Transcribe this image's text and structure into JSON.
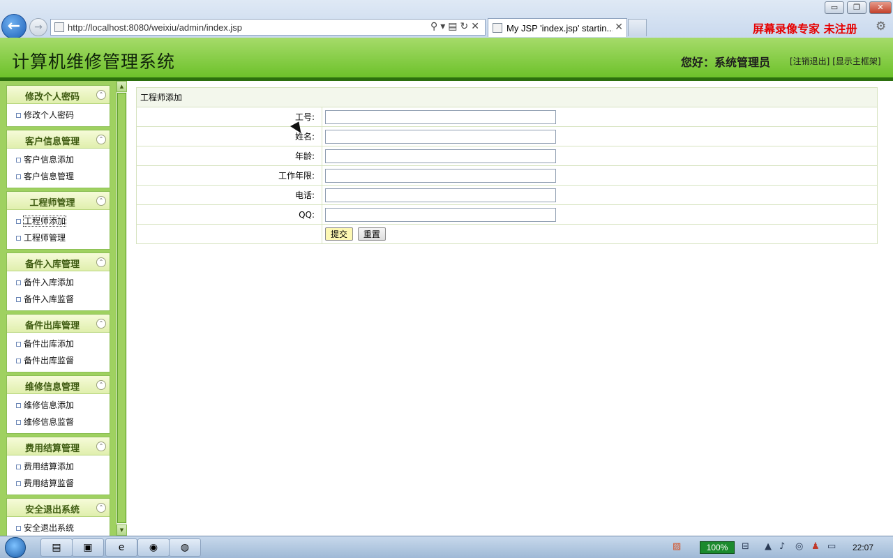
{
  "browser": {
    "url": "http://localhost:8080/weixiu/admin/index.jsp",
    "tab_title": "My JSP 'index.jsp' startin...",
    "overlay_text": "屏幕录像专家  未注册",
    "win_controls": {
      "minimize": "▭",
      "maximize": "❐",
      "close": "✕"
    }
  },
  "header": {
    "app_title": "计算机维修管理系统",
    "greeting": "您好：系统管理员",
    "logout_link": "[注销退出]",
    "show_frame_link": "[显示主框架]"
  },
  "sidebar": {
    "groups": [
      {
        "title": "修改个人密码",
        "items": [
          "修改个人密码"
        ]
      },
      {
        "title": "客户信息管理",
        "items": [
          "客户信息添加",
          "客户信息管理"
        ]
      },
      {
        "title": "工程师管理",
        "items": [
          "工程师添加",
          "工程师管理"
        ]
      },
      {
        "title": "备件入库管理",
        "items": [
          "备件入库添加",
          "备件入库监督"
        ]
      },
      {
        "title": "备件出库管理",
        "items": [
          "备件出库添加",
          "备件出库监督"
        ]
      },
      {
        "title": "维修信息管理",
        "items": [
          "维修信息添加",
          "维修信息监督"
        ]
      },
      {
        "title": "费用结算管理",
        "items": [
          "费用结算添加",
          "费用结算监督"
        ]
      },
      {
        "title": "安全退出系统",
        "items": [
          "安全退出系统"
        ]
      }
    ]
  },
  "form": {
    "caption": "工程师添加",
    "fields": [
      {
        "label": "工号:",
        "value": ""
      },
      {
        "label": "姓名:",
        "value": ""
      },
      {
        "label": "年龄:",
        "value": ""
      },
      {
        "label": "工作年限:",
        "value": ""
      },
      {
        "label": "电话:",
        "value": ""
      },
      {
        "label": "QQ:",
        "value": ""
      }
    ],
    "submit_label": "提交",
    "reset_label": "重置"
  },
  "taskbar": {
    "battery": "100%",
    "clock": "22:07"
  },
  "icons": {
    "collapse": "chevron-up-icon",
    "back": "arrow-left-icon",
    "forward": "arrow-right-icon"
  },
  "colors": {
    "header_green": "#6dc12a",
    "header_border": "#2c6f0e",
    "sidebar_green": "#9fd160",
    "recorder_red": "#e60000",
    "submit_yellow": "#fdf8b3"
  }
}
